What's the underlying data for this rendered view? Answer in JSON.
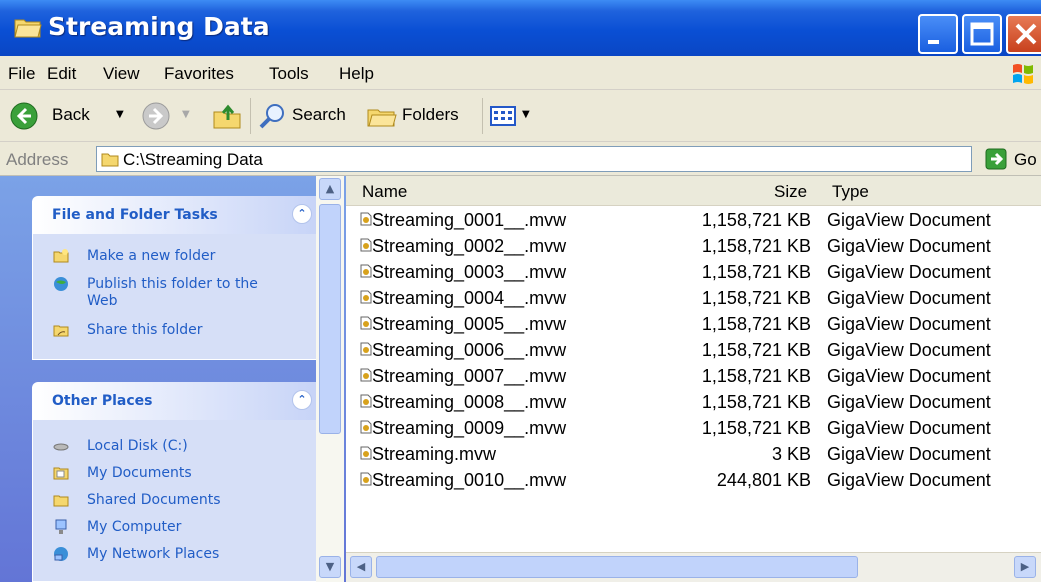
{
  "window": {
    "title": "Streaming Data"
  },
  "menu": [
    "File",
    "Edit",
    "View",
    "Favorites",
    "Tools",
    "Help"
  ],
  "toolbar": {
    "back": "Back",
    "search": "Search",
    "folders": "Folders"
  },
  "address": {
    "label": "Address",
    "value": "C:\\Streaming Data",
    "go": "Go"
  },
  "tasks_panel": {
    "title": "File and Folder Tasks",
    "items": [
      {
        "label": "Make a new folder",
        "icon": "new-folder-icon"
      },
      {
        "label": "Publish this folder to the Web",
        "icon": "publish-web-icon"
      },
      {
        "label": "Share this folder",
        "icon": "share-folder-icon"
      }
    ]
  },
  "places_panel": {
    "title": "Other Places",
    "items": [
      {
        "label": "Local Disk (C:)",
        "icon": "local-disk-icon"
      },
      {
        "label": "My Documents",
        "icon": "my-documents-icon"
      },
      {
        "label": "Shared Documents",
        "icon": "shared-documents-icon"
      },
      {
        "label": "My Computer",
        "icon": "my-computer-icon"
      },
      {
        "label": "My Network Places",
        "icon": "network-places-icon"
      }
    ]
  },
  "columns": {
    "name": "Name",
    "size": "Size",
    "type": "Type"
  },
  "files": [
    {
      "name": "Streaming_0001__.mvw",
      "size": "1,158,721 KB",
      "type": "GigaView Document"
    },
    {
      "name": "Streaming_0002__.mvw",
      "size": "1,158,721 KB",
      "type": "GigaView Document"
    },
    {
      "name": "Streaming_0003__.mvw",
      "size": "1,158,721 KB",
      "type": "GigaView Document"
    },
    {
      "name": "Streaming_0004__.mvw",
      "size": "1,158,721 KB",
      "type": "GigaView Document"
    },
    {
      "name": "Streaming_0005__.mvw",
      "size": "1,158,721 KB",
      "type": "GigaView Document"
    },
    {
      "name": "Streaming_0006__.mvw",
      "size": "1,158,721 KB",
      "type": "GigaView Document"
    },
    {
      "name": "Streaming_0007__.mvw",
      "size": "1,158,721 KB",
      "type": "GigaView Document"
    },
    {
      "name": "Streaming_0008__.mvw",
      "size": "1,158,721 KB",
      "type": "GigaView Document"
    },
    {
      "name": "Streaming_0009__.mvw",
      "size": "1,158,721 KB",
      "type": "GigaView Document"
    },
    {
      "name": "Streaming.mvw",
      "size": "3 KB",
      "type": "GigaView Document"
    },
    {
      "name": "Streaming_0010__.mvw",
      "size": "244,801 KB",
      "type": "GigaView Document"
    }
  ],
  "colors": {
    "title_bar": "#0a4fd4",
    "task_link": "#215dc6",
    "side_pane": "#7ba2e7",
    "close_button": "#c8411d"
  }
}
